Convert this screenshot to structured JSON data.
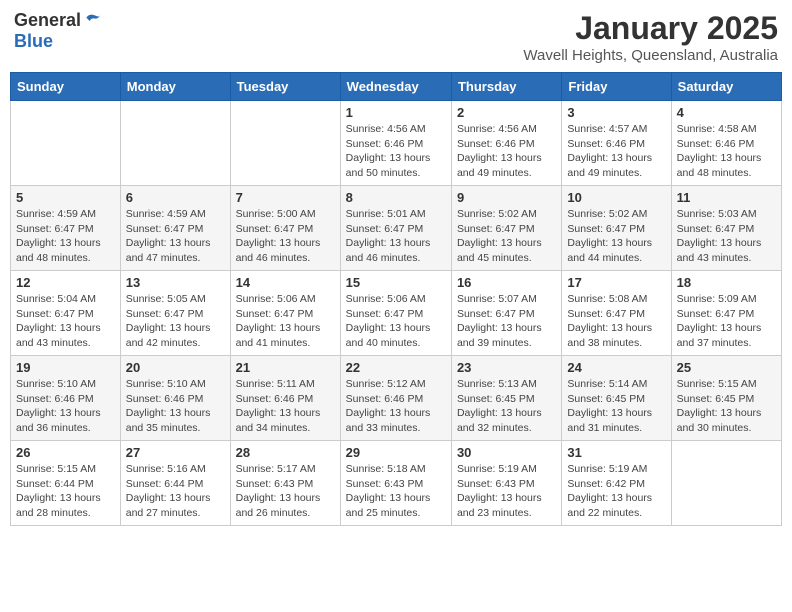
{
  "header": {
    "logo_general": "General",
    "logo_blue": "Blue",
    "month_title": "January 2025",
    "location": "Wavell Heights, Queensland, Australia"
  },
  "days_of_week": [
    "Sunday",
    "Monday",
    "Tuesday",
    "Wednesday",
    "Thursday",
    "Friday",
    "Saturday"
  ],
  "weeks": [
    [
      {
        "day": "",
        "info": ""
      },
      {
        "day": "",
        "info": ""
      },
      {
        "day": "",
        "info": ""
      },
      {
        "day": "1",
        "info": "Sunrise: 4:56 AM\nSunset: 6:46 PM\nDaylight: 13 hours\nand 50 minutes."
      },
      {
        "day": "2",
        "info": "Sunrise: 4:56 AM\nSunset: 6:46 PM\nDaylight: 13 hours\nand 49 minutes."
      },
      {
        "day": "3",
        "info": "Sunrise: 4:57 AM\nSunset: 6:46 PM\nDaylight: 13 hours\nand 49 minutes."
      },
      {
        "day": "4",
        "info": "Sunrise: 4:58 AM\nSunset: 6:46 PM\nDaylight: 13 hours\nand 48 minutes."
      }
    ],
    [
      {
        "day": "5",
        "info": "Sunrise: 4:59 AM\nSunset: 6:47 PM\nDaylight: 13 hours\nand 48 minutes."
      },
      {
        "day": "6",
        "info": "Sunrise: 4:59 AM\nSunset: 6:47 PM\nDaylight: 13 hours\nand 47 minutes."
      },
      {
        "day": "7",
        "info": "Sunrise: 5:00 AM\nSunset: 6:47 PM\nDaylight: 13 hours\nand 46 minutes."
      },
      {
        "day": "8",
        "info": "Sunrise: 5:01 AM\nSunset: 6:47 PM\nDaylight: 13 hours\nand 46 minutes."
      },
      {
        "day": "9",
        "info": "Sunrise: 5:02 AM\nSunset: 6:47 PM\nDaylight: 13 hours\nand 45 minutes."
      },
      {
        "day": "10",
        "info": "Sunrise: 5:02 AM\nSunset: 6:47 PM\nDaylight: 13 hours\nand 44 minutes."
      },
      {
        "day": "11",
        "info": "Sunrise: 5:03 AM\nSunset: 6:47 PM\nDaylight: 13 hours\nand 43 minutes."
      }
    ],
    [
      {
        "day": "12",
        "info": "Sunrise: 5:04 AM\nSunset: 6:47 PM\nDaylight: 13 hours\nand 43 minutes."
      },
      {
        "day": "13",
        "info": "Sunrise: 5:05 AM\nSunset: 6:47 PM\nDaylight: 13 hours\nand 42 minutes."
      },
      {
        "day": "14",
        "info": "Sunrise: 5:06 AM\nSunset: 6:47 PM\nDaylight: 13 hours\nand 41 minutes."
      },
      {
        "day": "15",
        "info": "Sunrise: 5:06 AM\nSunset: 6:47 PM\nDaylight: 13 hours\nand 40 minutes."
      },
      {
        "day": "16",
        "info": "Sunrise: 5:07 AM\nSunset: 6:47 PM\nDaylight: 13 hours\nand 39 minutes."
      },
      {
        "day": "17",
        "info": "Sunrise: 5:08 AM\nSunset: 6:47 PM\nDaylight: 13 hours\nand 38 minutes."
      },
      {
        "day": "18",
        "info": "Sunrise: 5:09 AM\nSunset: 6:47 PM\nDaylight: 13 hours\nand 37 minutes."
      }
    ],
    [
      {
        "day": "19",
        "info": "Sunrise: 5:10 AM\nSunset: 6:46 PM\nDaylight: 13 hours\nand 36 minutes."
      },
      {
        "day": "20",
        "info": "Sunrise: 5:10 AM\nSunset: 6:46 PM\nDaylight: 13 hours\nand 35 minutes."
      },
      {
        "day": "21",
        "info": "Sunrise: 5:11 AM\nSunset: 6:46 PM\nDaylight: 13 hours\nand 34 minutes."
      },
      {
        "day": "22",
        "info": "Sunrise: 5:12 AM\nSunset: 6:46 PM\nDaylight: 13 hours\nand 33 minutes."
      },
      {
        "day": "23",
        "info": "Sunrise: 5:13 AM\nSunset: 6:45 PM\nDaylight: 13 hours\nand 32 minutes."
      },
      {
        "day": "24",
        "info": "Sunrise: 5:14 AM\nSunset: 6:45 PM\nDaylight: 13 hours\nand 31 minutes."
      },
      {
        "day": "25",
        "info": "Sunrise: 5:15 AM\nSunset: 6:45 PM\nDaylight: 13 hours\nand 30 minutes."
      }
    ],
    [
      {
        "day": "26",
        "info": "Sunrise: 5:15 AM\nSunset: 6:44 PM\nDaylight: 13 hours\nand 28 minutes."
      },
      {
        "day": "27",
        "info": "Sunrise: 5:16 AM\nSunset: 6:44 PM\nDaylight: 13 hours\nand 27 minutes."
      },
      {
        "day": "28",
        "info": "Sunrise: 5:17 AM\nSunset: 6:43 PM\nDaylight: 13 hours\nand 26 minutes."
      },
      {
        "day": "29",
        "info": "Sunrise: 5:18 AM\nSunset: 6:43 PM\nDaylight: 13 hours\nand 25 minutes."
      },
      {
        "day": "30",
        "info": "Sunrise: 5:19 AM\nSunset: 6:43 PM\nDaylight: 13 hours\nand 23 minutes."
      },
      {
        "day": "31",
        "info": "Sunrise: 5:19 AM\nSunset: 6:42 PM\nDaylight: 13 hours\nand 22 minutes."
      },
      {
        "day": "",
        "info": ""
      }
    ]
  ]
}
